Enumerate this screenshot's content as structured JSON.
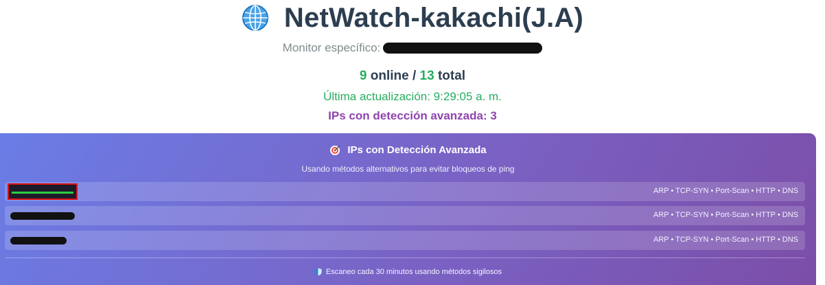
{
  "header": {
    "icon": "globe-icon",
    "title": "NetWatch-kakachi(J.A)",
    "monitor_label": "Monitor específico:",
    "online_count": "9",
    "online_label": " online / ",
    "total_count": "13",
    "total_label": " total",
    "last_update": "Última actualización: 9:29:05 a. m.",
    "advanced_count": "IPs con detección avanzada: 3"
  },
  "panel": {
    "icon": "target-icon",
    "title": "IPs con Detección Avanzada",
    "subtitle": "Usando métodos alternativos para evitar bloqueos de ping",
    "rows": [
      {
        "methods": "ARP • TCP-SYN • Port-Scan • HTTP • DNS"
      },
      {
        "methods": "ARP • TCP-SYN • Port-Scan • HTTP • DNS"
      },
      {
        "methods": "ARP • TCP-SYN • Port-Scan • HTTP • DNS"
      }
    ],
    "footer_icon": "shield-icon",
    "footer": "Escaneo cada 30 minutos usando métodos sigilosos"
  },
  "colors": {
    "title": "#2c3e50",
    "green": "#27ae60",
    "purple": "#8e44ad",
    "panel_start": "#6a7de6",
    "panel_end": "#7b4ea8"
  }
}
